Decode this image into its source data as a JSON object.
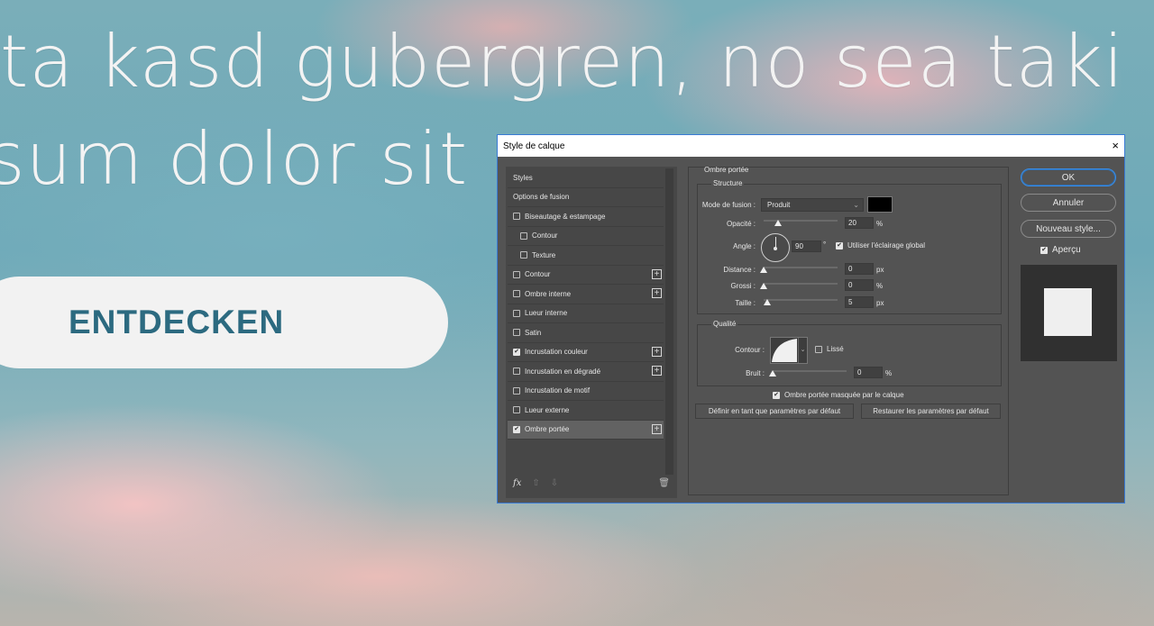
{
  "background": {
    "line1": "ta kasd gubergren, no sea taki",
    "line2": "sum dolor sit",
    "cta_label": "ENTDECKEN"
  },
  "dialog": {
    "title": "Style de calque",
    "close_icon": "×",
    "left_list": [
      {
        "label": "Styles",
        "checkbox": false,
        "checked": false,
        "plus": false,
        "indent": false
      },
      {
        "label": "Options de fusion",
        "checkbox": false,
        "checked": false,
        "plus": false,
        "indent": false
      },
      {
        "label": "Biseautage & estampage",
        "checkbox": true,
        "checked": false,
        "plus": false,
        "indent": false
      },
      {
        "label": "Contour",
        "checkbox": true,
        "checked": false,
        "plus": false,
        "indent": true
      },
      {
        "label": "Texture",
        "checkbox": true,
        "checked": false,
        "plus": false,
        "indent": true
      },
      {
        "label": "Contour",
        "checkbox": true,
        "checked": false,
        "plus": true,
        "indent": false
      },
      {
        "label": "Ombre interne",
        "checkbox": true,
        "checked": false,
        "plus": true,
        "indent": false
      },
      {
        "label": "Lueur interne",
        "checkbox": true,
        "checked": false,
        "plus": false,
        "indent": false
      },
      {
        "label": "Satin",
        "checkbox": true,
        "checked": false,
        "plus": false,
        "indent": false
      },
      {
        "label": "Incrustation couleur",
        "checkbox": true,
        "checked": true,
        "plus": true,
        "indent": false
      },
      {
        "label": "Incrustation en dégradé",
        "checkbox": true,
        "checked": false,
        "plus": true,
        "indent": false
      },
      {
        "label": "Incrustation de motif",
        "checkbox": true,
        "checked": false,
        "plus": false,
        "indent": false
      },
      {
        "label": "Lueur externe",
        "checkbox": true,
        "checked": false,
        "plus": false,
        "indent": false
      },
      {
        "label": "Ombre portée",
        "checkbox": true,
        "checked": true,
        "plus": true,
        "indent": false,
        "selected": true
      }
    ],
    "footer": {
      "fx": "fx",
      "up": "⇧",
      "down": "⇩",
      "trash": "🗑"
    },
    "panel": {
      "section_title": "Ombre portée",
      "structure": {
        "title": "Structure",
        "blend_mode_label": "Mode de fusion :",
        "blend_mode_value": "Produit",
        "opacity_label": "Opacité :",
        "opacity_value": "20",
        "opacity_unit": "%",
        "opacity_level": 0.2,
        "angle_label": "Angle :",
        "angle_value": "90",
        "angle_unit": "°",
        "global_light_label": "Utiliser l'éclairage global",
        "distance_label": "Distance :",
        "distance_value": "0",
        "distance_unit": "px",
        "spread_label": "Grossi :",
        "spread_value": "0",
        "spread_unit": "%",
        "size_label": "Taille :",
        "size_value": "5",
        "size_unit": "px"
      },
      "quality": {
        "title": "Qualité",
        "contour_label": "Contour :",
        "antialias_label": "Lissé",
        "noise_label": "Bruit :",
        "noise_value": "0",
        "noise_unit": "%"
      },
      "knockout_label": "Ombre portée masquée par le calque",
      "set_default_label": "Définir en tant que paramètres par défaut",
      "reset_default_label": "Restaurer les paramètres par défaut"
    },
    "right": {
      "ok": "OK",
      "cancel": "Annuler",
      "new_style": "Nouveau style...",
      "preview_label": "Aperçu"
    }
  }
}
